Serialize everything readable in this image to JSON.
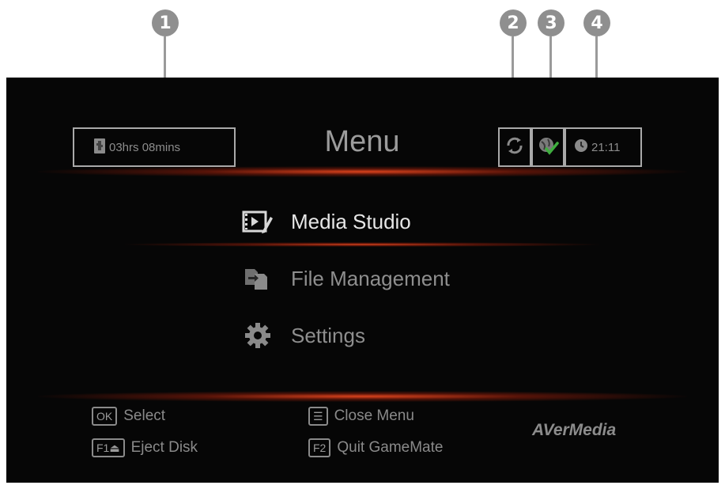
{
  "callouts": [
    "1",
    "2",
    "3",
    "4"
  ],
  "status": {
    "storage_icon": "usb-stick-icon",
    "storage_text": "03hrs 08mins",
    "sync_icon": "sync-icon",
    "network_icon": "network-globe-icon",
    "time": "21:11",
    "clock_icon": "clock-icon"
  },
  "menu": {
    "title": "Menu",
    "items": [
      {
        "label": "Media Studio",
        "icon": "film-edit-icon",
        "color": "#e6e6e6"
      },
      {
        "label": "File Management",
        "icon": "file-management-icon",
        "color": "#8e8e8e"
      },
      {
        "label": "Settings",
        "icon": "gear-icon",
        "color": "#8e8e8e"
      }
    ]
  },
  "hints": [
    {
      "key": "OK",
      "label": "Select"
    },
    {
      "key": "F1⏏",
      "label": "Eject Disk"
    },
    {
      "key": "☰",
      "label": "Close Menu"
    },
    {
      "key": "F2",
      "label": "Quit GameMate"
    }
  ],
  "brand": "AVerMedia",
  "colors": {
    "background": "#060606",
    "glow": "#e6461e",
    "frame": "#a9a9a9"
  }
}
